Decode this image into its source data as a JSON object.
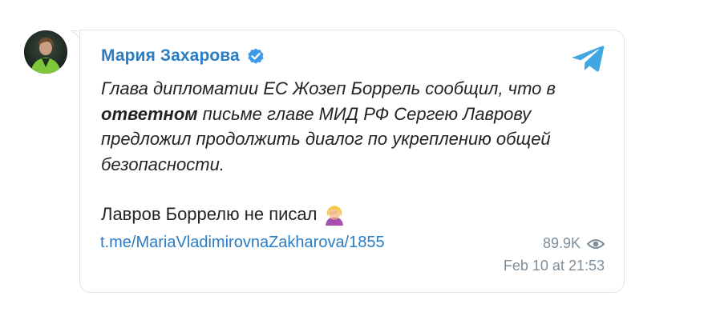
{
  "post": {
    "author": "Мария Захарова",
    "text": {
      "part1": "Глава дипломатии ЕС Жозеп Боррель сообщил, что в ",
      "bold": "ответном",
      "part2": " письме главе МИД РФ Сергею Лаврову предложил продолжить диалог по укреплению общей безопасности.",
      "line2": "Лавров Борре­лю не писал"
    },
    "link": "t.me/MariaVladimirovnaZakharova/1855",
    "views": "89.9K",
    "date": "Feb 10 at 21:53"
  },
  "icons": {
    "verified": "verified-badge-icon",
    "telegram": "telegram-plane-icon",
    "eye": "eye-icon",
    "emoji": "facepalm-woman-emoji"
  },
  "colors": {
    "accent": "#2a7cc4",
    "verified": "#3d9ae8",
    "telegram": "#40a7e3",
    "muted": "#7d8d99",
    "text": "#232323",
    "border": "#dde3e8"
  }
}
